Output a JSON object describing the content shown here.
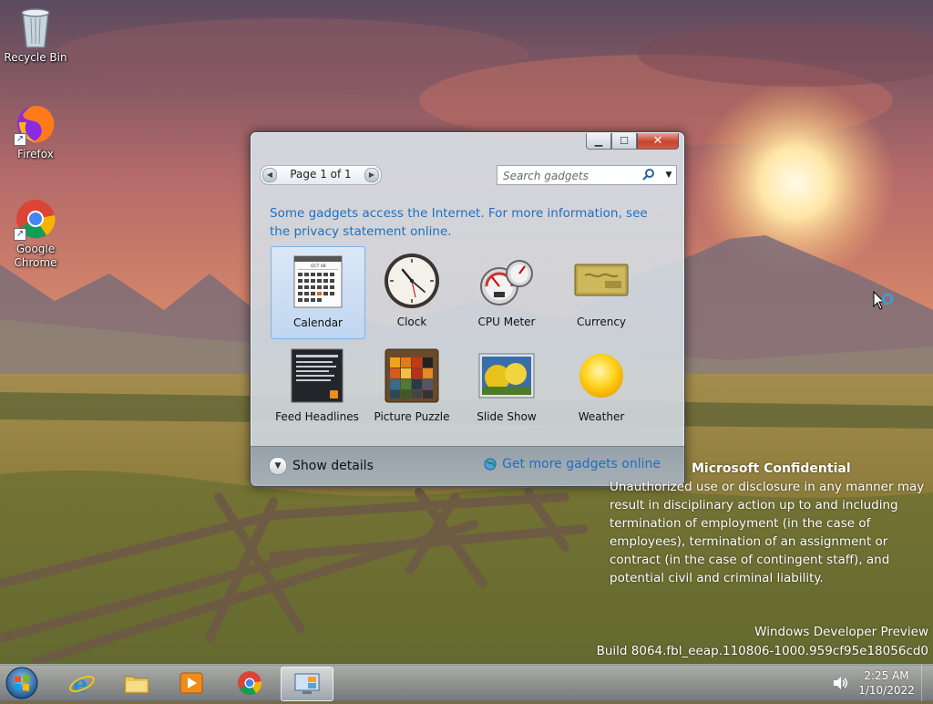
{
  "desktop": {
    "icons": [
      {
        "label": "Recycle Bin",
        "icon": "recycle-bin-icon"
      },
      {
        "label": "Firefox",
        "icon": "firefox-icon"
      },
      {
        "label": "Google Chrome",
        "icon": "chrome-icon"
      }
    ]
  },
  "gadget_window": {
    "pager_label": "Page 1 of 1",
    "search_placeholder": "Search gadgets",
    "notice": "Some gadgets access the Internet.  For more information, see the privacy statement online.",
    "gadgets": [
      {
        "label": "Calendar",
        "icon": "calendar-icon",
        "selected": true
      },
      {
        "label": "Clock",
        "icon": "clock-icon",
        "selected": false
      },
      {
        "label": "CPU Meter",
        "icon": "cpu-meter-icon",
        "selected": false
      },
      {
        "label": "Currency",
        "icon": "currency-icon",
        "selected": false
      },
      {
        "label": "Feed Headlines",
        "icon": "feed-headlines-icon",
        "selected": false
      },
      {
        "label": "Picture Puzzle",
        "icon": "picture-puzzle-icon",
        "selected": false
      },
      {
        "label": "Slide Show",
        "icon": "slide-show-icon",
        "selected": false
      },
      {
        "label": "Weather",
        "icon": "weather-icon",
        "selected": false
      }
    ],
    "calendar_month": "OCT 08",
    "show_details": "Show details",
    "get_more": "Get more gadgets online"
  },
  "watermark": {
    "title": "Microsoft Confidential",
    "body": "Unauthorized use or disclosure in any manner may result in disciplinary action up to and including termination of employment (in the case of employees), termination of an assignment or contract (in the case of contingent staff), and potential civil and criminal liability.",
    "build_line1": "Windows Developer Preview",
    "build_line2": "Build 8064.fbl_eeap.110806-1000.959cf95e18056cd0"
  },
  "taskbar": {
    "pinned": [
      "internet-explorer-icon",
      "file-explorer-icon",
      "media-player-icon",
      "chrome-icon",
      "gadgets-icon"
    ],
    "time": "2:25 AM",
    "date": "1/10/2022"
  },
  "colors": {
    "link": "#1f6fbf",
    "close_button": "#c7442f"
  }
}
